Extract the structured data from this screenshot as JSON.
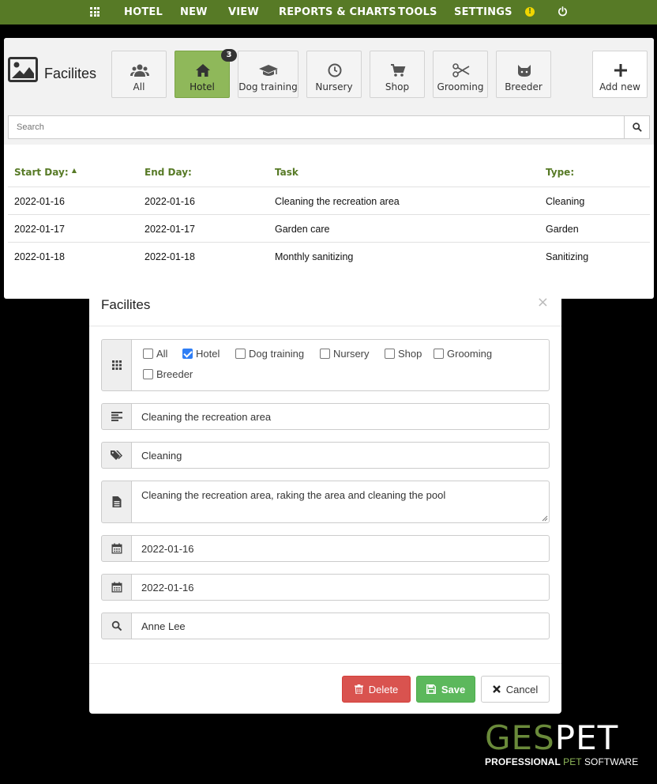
{
  "nav": {
    "items": [
      "HOTEL",
      "NEW",
      "VIEW",
      "REPORTS & CHARTS",
      "TOOLS",
      "SETTINGS"
    ],
    "warning_symbol": "!"
  },
  "header": {
    "title": "Facilites",
    "categories": [
      {
        "label": "All",
        "icon": "users-icon",
        "active": false
      },
      {
        "label": "Hotel",
        "icon": "home-icon",
        "active": true,
        "badge": "3"
      },
      {
        "label": "Dog training",
        "icon": "graduation-cap-icon",
        "active": false
      },
      {
        "label": "Nursery",
        "icon": "clock-icon",
        "active": false
      },
      {
        "label": "Shop",
        "icon": "cart-icon",
        "active": false
      },
      {
        "label": "Grooming",
        "icon": "scissors-icon",
        "active": false
      },
      {
        "label": "Breeder",
        "icon": "cat-icon",
        "active": false
      }
    ],
    "add_new_label": "Add new"
  },
  "search": {
    "placeholder": "Search"
  },
  "table": {
    "columns": [
      "Start Day:",
      "End Day:",
      "Task",
      "Type:"
    ],
    "sort_indicator": "▲",
    "rows": [
      {
        "start": "2022-01-16",
        "end": "2022-01-16",
        "task": "Cleaning the recreation area",
        "type": "Cleaning"
      },
      {
        "start": "2022-01-17",
        "end": "2022-01-17",
        "task": "Garden care",
        "type": "Garden"
      },
      {
        "start": "2022-01-18",
        "end": "2022-01-18",
        "task": "Monthly sanitizing",
        "type": "Sanitizing"
      }
    ]
  },
  "modal": {
    "title": "Facilites",
    "close_symbol": "×",
    "checkboxes": [
      {
        "label": "All",
        "checked": false
      },
      {
        "label": "Hotel",
        "checked": true
      },
      {
        "label": "Dog training",
        "checked": false
      },
      {
        "label": "Nursery",
        "checked": false
      },
      {
        "label": "Shop",
        "checked": false
      },
      {
        "label": "Grooming",
        "checked": false
      },
      {
        "label": "Breeder",
        "checked": false
      }
    ],
    "task_value": "Cleaning the recreation area",
    "type_value": "Cleaning",
    "description_value": "Cleaning the recreation area, raking the area and cleaning the pool",
    "start_date_value": "2022-01-16",
    "end_date_value": "2022-01-16",
    "person_value": "Anne Lee",
    "delete_label": "Delete",
    "save_label": "Save",
    "cancel_label": "Cancel"
  },
  "logo": {
    "main_part1": "GES",
    "main_part2": "PET",
    "sub_part1": "PROFESSIONAL ",
    "sub_part2": "PET",
    "sub_part3": " SOFTWARE"
  },
  "colors": {
    "nav_green": "#577a26",
    "active_green": "#8fb85a",
    "delete_red": "#d9534f",
    "save_green": "#5cb85c",
    "checkbox_blue": "#2f7ef5"
  }
}
